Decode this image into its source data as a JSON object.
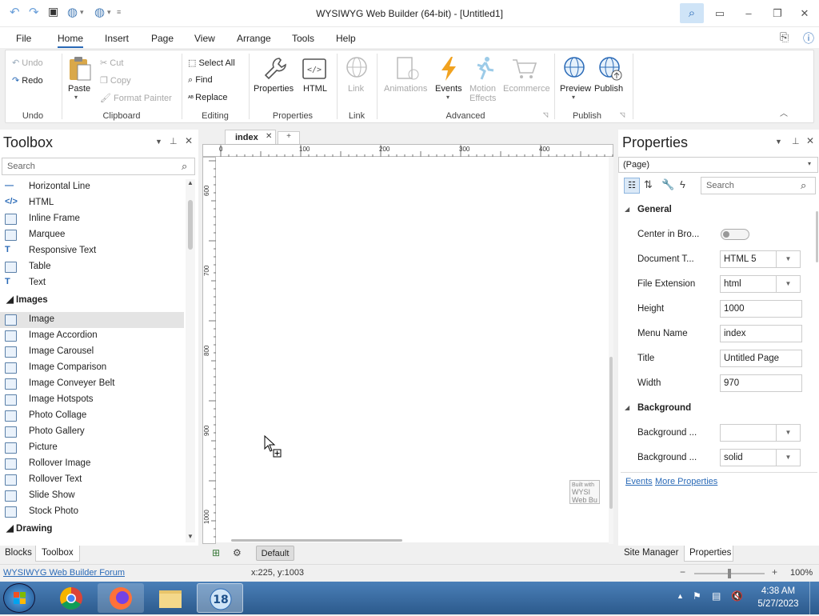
{
  "window": {
    "title": "WYSIWYG Web Builder (64-bit) - [Untitled1]",
    "buttons": [
      "minimize-icon",
      "restore-icon",
      "close-icon"
    ]
  },
  "menubar": {
    "items": [
      "File",
      "Home",
      "Insert",
      "Page",
      "View",
      "Arrange",
      "Tools",
      "Help"
    ],
    "active": "Home"
  },
  "ribbon": {
    "undo": {
      "undo": "Undo",
      "redo": "Redo",
      "group": "Undo"
    },
    "clipboard": {
      "paste": "Paste",
      "cut": "Cut",
      "copy": "Copy",
      "format_painter": "Format Painter",
      "group": "Clipboard"
    },
    "editing": {
      "select_all": "Select All",
      "find": "Find",
      "replace": "Replace",
      "group": "Editing"
    },
    "properties": {
      "properties": "Properties",
      "html": "HTML",
      "group": "Properties"
    },
    "link": {
      "link": "Link",
      "group": "Link"
    },
    "advanced": {
      "animations": "Animations",
      "events": "Events",
      "motion_effects_1": "Motion",
      "motion_effects_2": "Effects",
      "ecommerce": "Ecommerce",
      "group": "Advanced"
    },
    "publish": {
      "preview": "Preview",
      "publish": "Publish",
      "group": "Publish"
    }
  },
  "toolbox": {
    "title": "Toolbox",
    "search_placeholder": "Search",
    "items_top": [
      "Horizontal Line",
      "HTML",
      "Inline Frame",
      "Marquee",
      "Responsive Text",
      "Table",
      "Text"
    ],
    "category_images": "Images",
    "images": [
      "Image",
      "Image Accordion",
      "Image Carousel",
      "Image Comparison",
      "Image Conveyer Belt",
      "Image Hotspots",
      "Photo Collage",
      "Photo Gallery",
      "Picture",
      "Rollover Image",
      "Rollover Text",
      "Slide Show",
      "Stock Photo"
    ],
    "selected": "Image",
    "category_drawing": "Drawing",
    "tabs": [
      "Blocks",
      "Toolbox"
    ],
    "active_tab": "Toolbox"
  },
  "editor": {
    "tab_label": "index",
    "ruler_top": [
      "0",
      "100",
      "200",
      "300",
      "400"
    ],
    "ruler_left": [
      "600",
      "700",
      "800",
      "900",
      "1000"
    ],
    "watermark": [
      "Built with",
      "WYSI",
      "Web Bu"
    ],
    "breakpoint": "Default"
  },
  "properties": {
    "title": "Properties",
    "object": "(Page)",
    "search_placeholder": "Search",
    "section_general": "General",
    "rows": [
      {
        "label": "Center in Bro...",
        "type": "toggle",
        "value": ""
      },
      {
        "label": "Document T...",
        "type": "dropdown",
        "value": "HTML 5"
      },
      {
        "label": "File Extension",
        "type": "dropdown",
        "value": "html"
      },
      {
        "label": "Height",
        "type": "text",
        "value": "1000"
      },
      {
        "label": "Menu Name",
        "type": "text",
        "value": "index"
      },
      {
        "label": "Title",
        "type": "text",
        "value": "Untitled Page"
      },
      {
        "label": "Width",
        "type": "text",
        "value": "970"
      }
    ],
    "section_background": "Background",
    "bg_rows": [
      {
        "label": "Background ...",
        "value": ""
      },
      {
        "label": "Background ...",
        "value": "solid"
      }
    ],
    "links": [
      "Events",
      "More Properties"
    ],
    "tabs": [
      "Site Manager",
      "Properties"
    ],
    "active_tab": "Properties"
  },
  "status": {
    "link": "WYSIWYG Web Builder Forum",
    "coords": "x:225, y:1003",
    "zoom": "100%"
  },
  "taskbar": {
    "time": "4:38 AM",
    "date": "5/27/2023"
  }
}
